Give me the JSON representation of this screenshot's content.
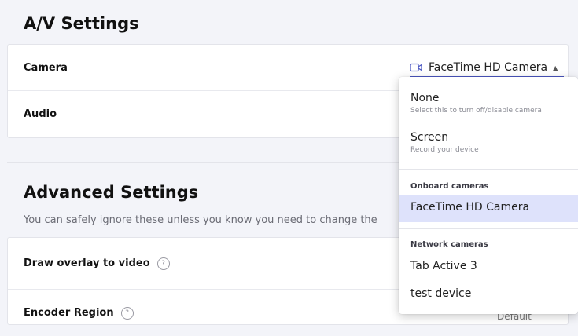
{
  "av_section": {
    "title": "A/V Settings",
    "rows": [
      {
        "label": "Camera",
        "value": "FaceTime HD Camera"
      },
      {
        "label": "Audio"
      }
    ]
  },
  "advanced_section": {
    "title": "Advanced Settings",
    "subtitle": "You can safely ignore these unless you know you need to change the",
    "rows": [
      {
        "label": "Draw overlay to video",
        "help": "?"
      },
      {
        "label": "Encoder Region",
        "help": "?",
        "value": "Default"
      }
    ]
  },
  "camera_dropdown": {
    "options": [
      {
        "label": "None",
        "description": "Select this to turn off/disable camera"
      },
      {
        "label": "Screen",
        "description": "Record your device"
      }
    ],
    "groups": [
      {
        "title": "Onboard cameras",
        "options": [
          {
            "label": "FaceTime HD Camera",
            "selected": true
          }
        ]
      },
      {
        "title": "Network cameras",
        "options": [
          {
            "label": "Tab Active 3"
          },
          {
            "label": "test device"
          }
        ]
      }
    ]
  },
  "colors": {
    "accent": "#4b57c2",
    "selected_bg": "#dee2fb",
    "page_bg": "#f3f4f9"
  },
  "icons": [
    "video-camera-icon",
    "caret-up-icon",
    "help-icon"
  ]
}
